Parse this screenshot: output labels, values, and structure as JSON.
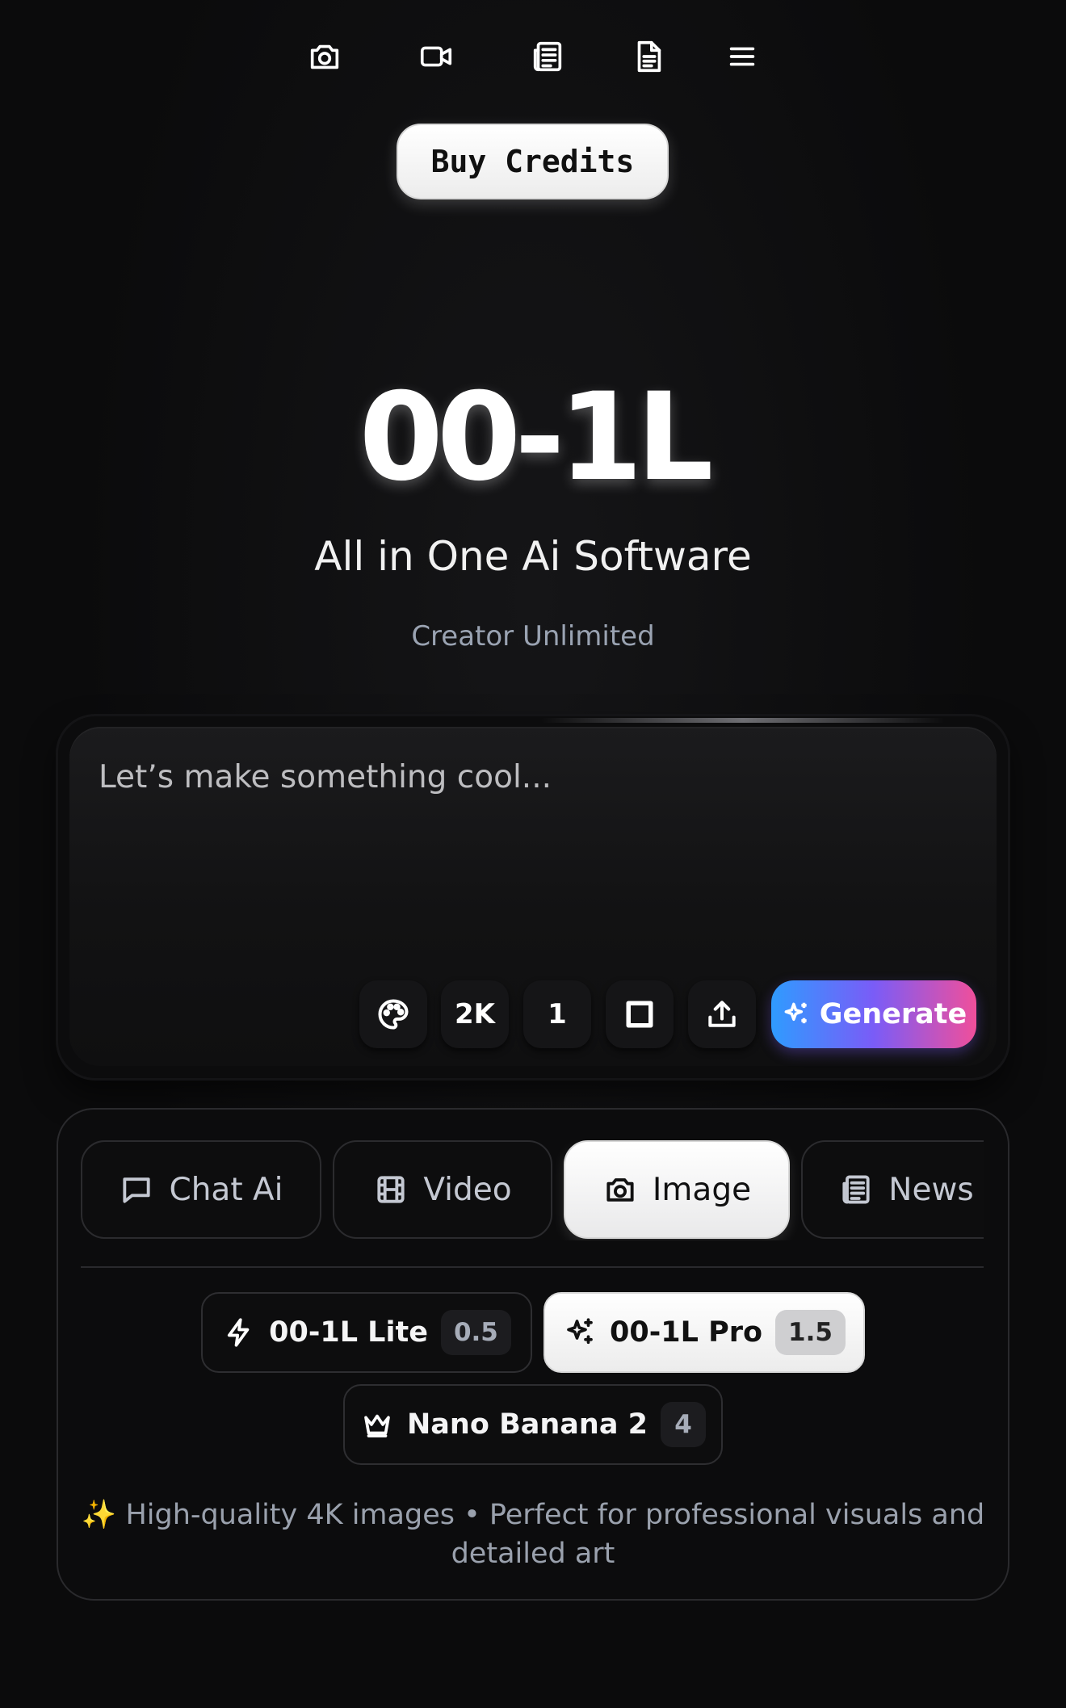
{
  "nav": {
    "items": [
      {
        "name": "camera-icon"
      },
      {
        "name": "video-icon"
      },
      {
        "name": "newspaper-icon"
      },
      {
        "name": "document-icon"
      },
      {
        "name": "menu-icon"
      }
    ]
  },
  "header": {
    "buy_label": "Buy Credits"
  },
  "hero": {
    "title": "00-1L",
    "subtitle": "All in One Ai Software",
    "tagline": "Creator Unlimited"
  },
  "prompt": {
    "placeholder": "Let’s make something cool..."
  },
  "toolbar": {
    "resolution": "2K",
    "count": "1",
    "generate_label": "Generate"
  },
  "tabs": [
    {
      "label": "Chat Ai",
      "icon": "chat-icon"
    },
    {
      "label": "Video",
      "icon": "film-icon"
    },
    {
      "label": "Image",
      "icon": "camera-icon",
      "active": true
    },
    {
      "label": "News",
      "icon": "newspaper-icon"
    }
  ],
  "models": [
    {
      "label": "00-1L Lite",
      "cost": "0.5",
      "icon": "bolt-icon"
    },
    {
      "label": "00-1L Pro",
      "cost": "1.5",
      "icon": "sparkle-icon",
      "active": true
    },
    {
      "label": "Nano Banana 2",
      "cost": "4",
      "icon": "crown-icon"
    }
  ],
  "description": "✨ High-quality 4K images • Perfect for professional visuals and detailed art",
  "colors": {
    "background": "#0b0b0c",
    "generate_gradient": [
      "#2f9bff",
      "#7a5cf7",
      "#f04f9b"
    ]
  }
}
